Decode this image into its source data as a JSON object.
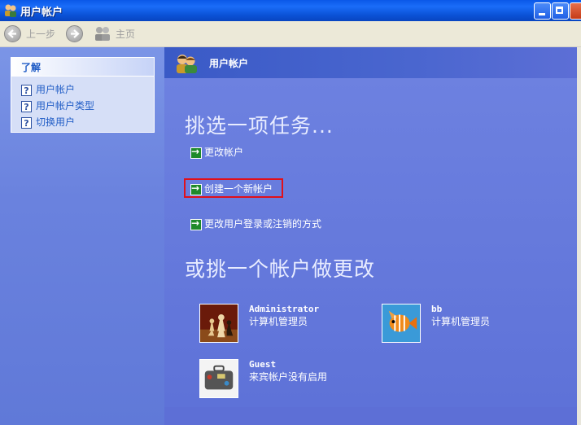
{
  "window": {
    "title": "用户帐户"
  },
  "toolbar": {
    "back_label": "上一步",
    "home_label": "主页"
  },
  "sidebar": {
    "learn_title": "了解",
    "items": [
      {
        "label": "用户帐户"
      },
      {
        "label": "用户帐户类型"
      },
      {
        "label": "切换用户"
      }
    ]
  },
  "main": {
    "header_title": "用户帐户",
    "task_heading": "挑选一项任务...",
    "tasks": [
      {
        "label": "更改帐户"
      },
      {
        "label": "创建一个新帐户"
      },
      {
        "label": "更改用户登录或注销的方式"
      }
    ],
    "account_heading": "或挑一个帐户做更改",
    "accounts": [
      {
        "name": "Administrator",
        "type": "计算机管理员",
        "picture": "chess-icon"
      },
      {
        "name": "bb",
        "type": "计算机管理员",
        "picture": "fish-icon"
      },
      {
        "name": "Guest",
        "type": "来宾帐户没有启用",
        "picture": "suitcase-icon"
      }
    ]
  },
  "colors": {
    "accent": "#215dc6",
    "highlight_border": "#e0101a",
    "task_arrow": "#1f8a2a"
  }
}
